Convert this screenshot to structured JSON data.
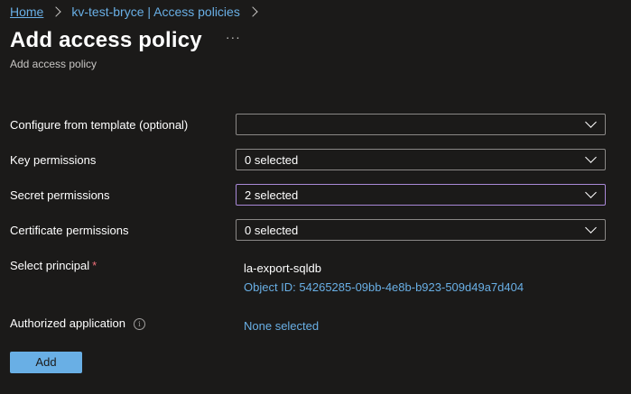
{
  "breadcrumb": {
    "items": [
      "Home",
      "kv-test-bryce | Access policies"
    ]
  },
  "header": {
    "title": "Add access policy",
    "more_label": "···",
    "subtitle": "Add access policy"
  },
  "form": {
    "template": {
      "label": "Configure from template (optional)",
      "value": ""
    },
    "key_permissions": {
      "label": "Key permissions",
      "value": "0 selected"
    },
    "secret_permissions": {
      "label": "Secret permissions",
      "value": "2 selected"
    },
    "certificate_permissions": {
      "label": "Certificate permissions",
      "value": "0 selected"
    },
    "principal": {
      "label": "Select principal",
      "required_mark": "*",
      "name": "la-export-sqldb",
      "object_id": "Object ID: 54265285-09bb-4e8b-b923-509d49a7d404"
    },
    "authorized_application": {
      "label": "Authorized application",
      "info_glyph": "i",
      "value": "None selected"
    }
  },
  "actions": {
    "add_label": "Add"
  },
  "colors": {
    "background": "#1b1a19",
    "link": "#69afe5",
    "focus_border": "#a989d8",
    "required": "#f1707b",
    "primary_button": "#69afe5"
  }
}
